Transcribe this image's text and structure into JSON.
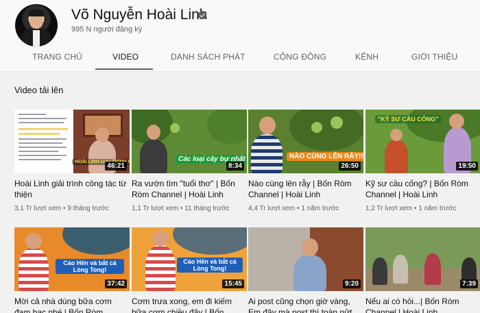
{
  "channel": {
    "name": "Võ Nguyễn Hoài Linh",
    "subscribers": "995 N người đăng ký",
    "accent": "#0f0f0f"
  },
  "tabs": [
    {
      "label": "TRANG CHỦ",
      "active": false
    },
    {
      "label": "VIDEO",
      "active": true
    },
    {
      "label": "DANH SÁCH PHÁT",
      "active": false
    },
    {
      "label": "CỘNG ĐỒNG",
      "active": false
    },
    {
      "label": "KÊNH",
      "active": false
    },
    {
      "label": "GIỚI THIỆU",
      "active": false
    }
  ],
  "section": {
    "title": "Video tải lên"
  },
  "videos": [
    {
      "title": "Hoài Linh giải trình công tác từ thiện",
      "views": "3,1 Tr lượt xem",
      "age": "9 tháng trước",
      "duration": "46:21",
      "overlay": "HOÀI LINH GIẢI TRÌNH CÔNG TÁC TỪ THIỆN"
    },
    {
      "title": "Ra vườn tìm \"tuổi thơ\" | Bốn Ròm Channel | Hoài Linh",
      "views": "1,1 Tr lượt xem",
      "age": "11 tháng trước",
      "duration": "8:34",
      "overlay": "Các loại cây bự nhất"
    },
    {
      "title": "Nào cùng lên rẫy | Bốn Ròm Channel | Hoài Linh",
      "views": "4,4 Tr lượt xem",
      "age": "1 năm trước",
      "duration": "26:50",
      "overlay": "NÀO CÙNG LÊN RẪY!!!"
    },
    {
      "title": "Kỹ sư cầu cống? | Bốn Ròm Channel | Hoài Linh",
      "views": "1,2 Tr lượt xem",
      "age": "1 năm trước",
      "duration": "19:50",
      "overlay": "\"KỸ SƯ CẦU CỐNG\""
    },
    {
      "title": "Mời cả nhà dùng bữa cơm đạm bạc nhé | Bốn Ròm",
      "views": "",
      "age": "",
      "duration": "37:42",
      "overlay": "Cáo Hến và bắt cá Lòng Tong!"
    },
    {
      "title": "Cơm trưa xong, em đi kiếm bữa cơm chiều đây | Bốn",
      "views": "",
      "age": "",
      "duration": "15:45",
      "overlay": "Cáo Hến và bắt cá Lòng Tong!"
    },
    {
      "title": "Ai post cũng chọn giờ vàng, Em đây mà post thì toàn nửt",
      "views": "",
      "age": "",
      "duration": "9:20",
      "overlay": ""
    },
    {
      "title": "Nếu ai có hỏi...| Bốn Ròm Channel | Hoài Linh",
      "views": "",
      "age": "",
      "duration": "7:39",
      "overlay": ""
    }
  ]
}
